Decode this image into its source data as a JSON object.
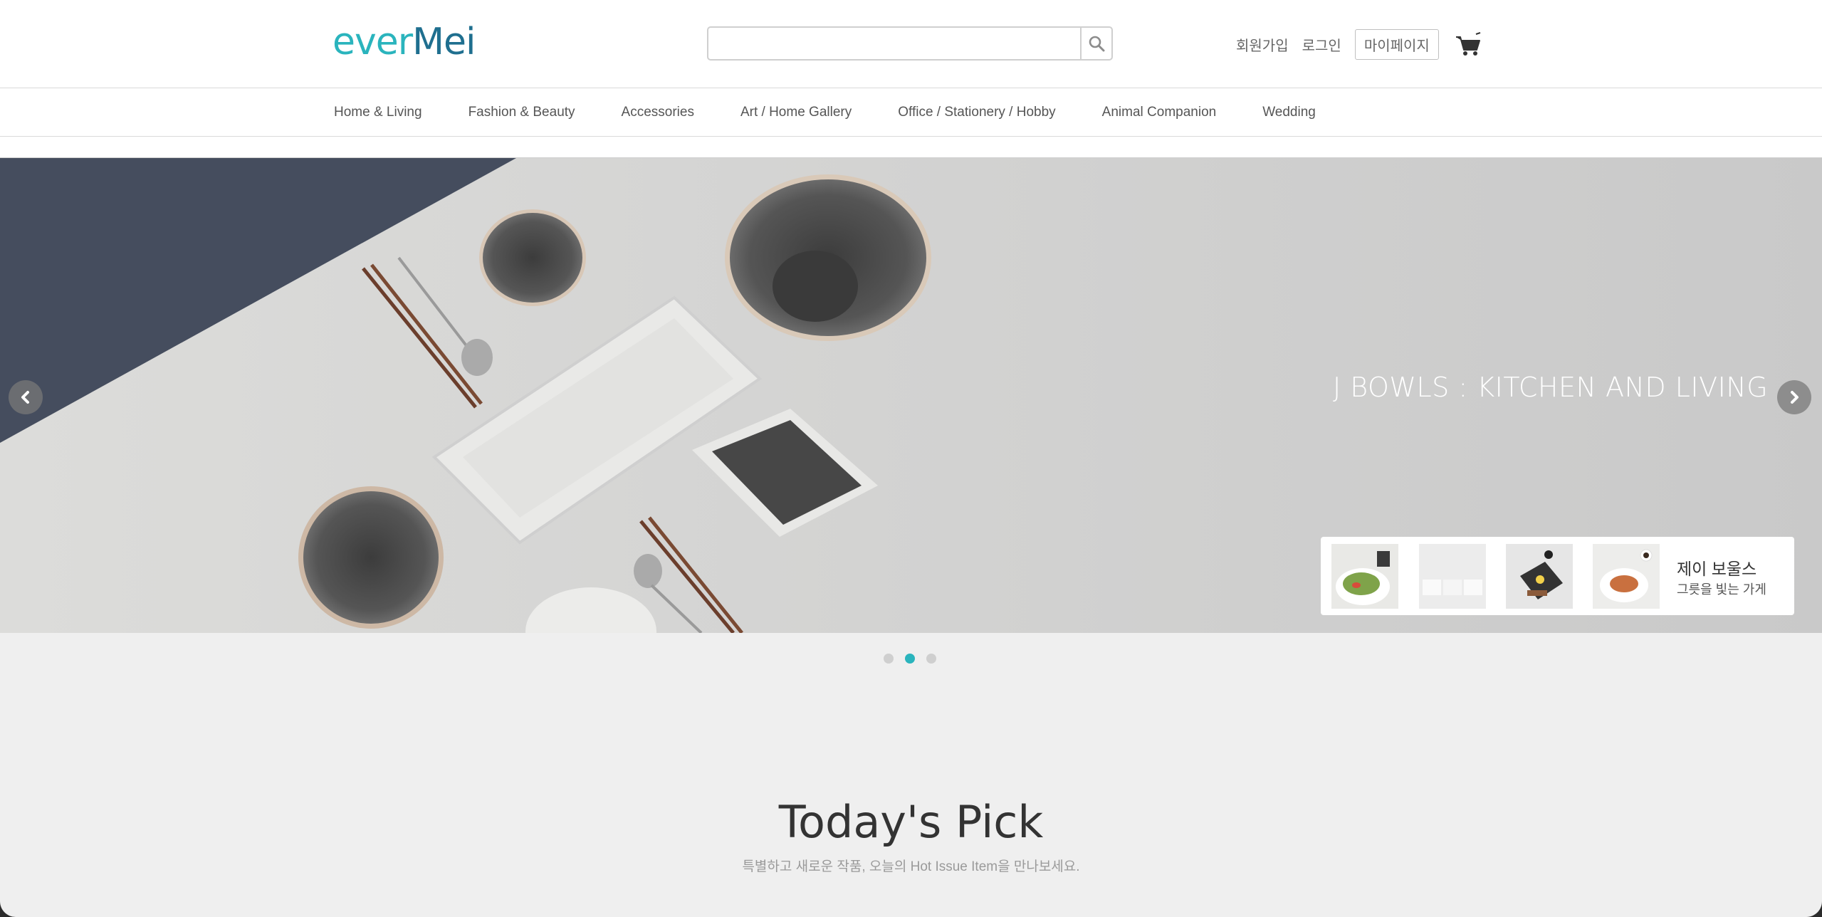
{
  "header": {
    "logo_text_1": "ever",
    "logo_text_2": "Mei",
    "search_placeholder": "",
    "links": {
      "signup": "회원가입",
      "login": "로그인",
      "mypage": "마이페이지"
    }
  },
  "nav": {
    "items": [
      "Home & Living",
      "Fashion & Beauty",
      "Accessories",
      "Art / Home Gallery",
      "Office / Stationery / Hobby",
      "Animal Companion",
      "Wedding"
    ]
  },
  "hero": {
    "title": "J  BOWLS : KITCHEN AND LIVING",
    "card": {
      "title": "제이 보울스",
      "subtitle": "그릇을 빛는 가게"
    }
  },
  "slider": {
    "count": 3,
    "active": 2
  },
  "section": {
    "title": "Today's Pick",
    "subtitle": "특별하고 새로운 작품, 오늘의 Hot Issue Item을 만나보세요."
  },
  "colors": {
    "accent": "#2ab4bd",
    "logo_m": "#1f6f8f"
  }
}
